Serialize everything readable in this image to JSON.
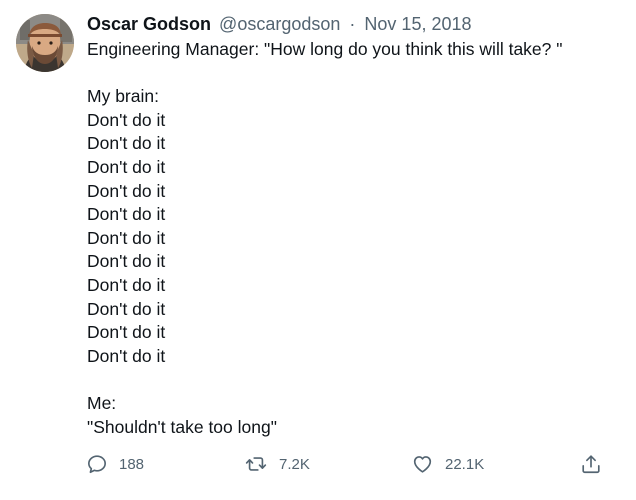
{
  "tweet": {
    "author": {
      "display_name": "Oscar Godson",
      "handle": "@oscargodson"
    },
    "separator": "·",
    "date": "Nov 15, 2018",
    "text_lines": [
      "Engineering Manager: \"How long do you think this will take? \"",
      "",
      "My brain:",
      "Don't do it",
      "Don't do it",
      "Don't do it",
      "Don't do it",
      "Don't do it",
      "Don't do it",
      "Don't do it",
      "Don't do it",
      "Don't do it",
      "Don't do it",
      "Don't do it",
      "",
      "Me:",
      "\"Shouldn't take too long\""
    ]
  },
  "actions": {
    "reply": {
      "icon": "reply-icon",
      "count": "188"
    },
    "retweet": {
      "icon": "retweet-icon",
      "count": "7.2K"
    },
    "like": {
      "icon": "heart-icon",
      "count": "22.1K"
    },
    "share": {
      "icon": "share-icon"
    }
  },
  "colors": {
    "text": "#0f1419",
    "secondary": "#536471",
    "background": "#ffffff"
  }
}
